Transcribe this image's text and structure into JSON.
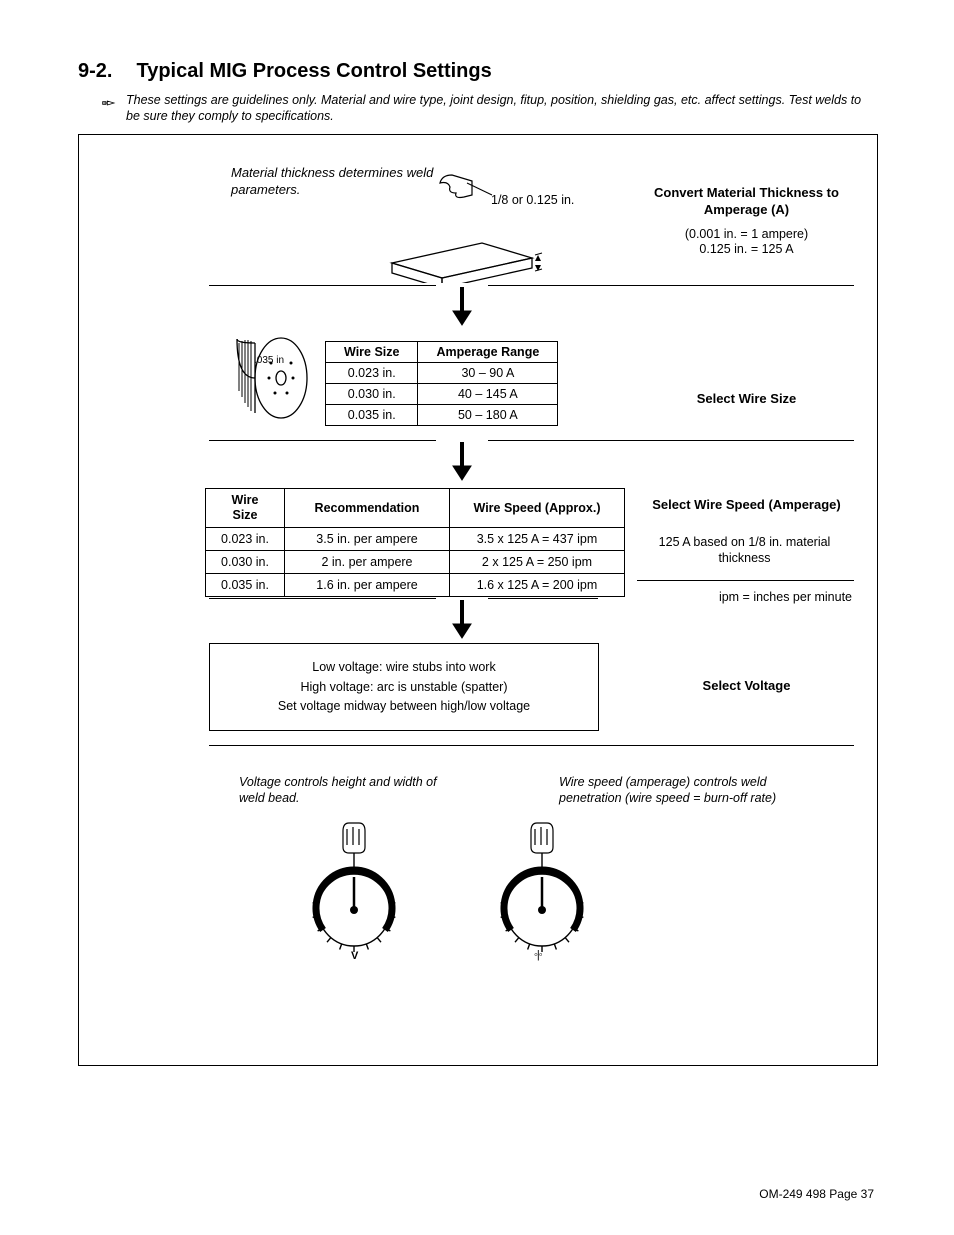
{
  "heading_number": "9-2.",
  "heading_text": "Typical MIG Process Control Settings",
  "note": "These settings are guidelines only. Material and wire type, joint design, fitup, position, shielding gas, etc. affect settings. Test welds to be sure they comply to specifications.",
  "step1": {
    "caption": "Material thickness determines weld parameters.",
    "callout": "1/8 or 0.125 in.",
    "title": "Convert Material Thickness to Amperage (A)",
    "eq1": "(0.001 in.  =  1 ampere)",
    "eq2": "0.125 in.  =  125 A"
  },
  "step2": {
    "spool_label": ".035 in",
    "col1": "Wire Size",
    "col2": "Amperage Range",
    "rows": [
      {
        "a": "0.023 in.",
        "b": "30 – 90 A"
      },
      {
        "a": "0.030 in.",
        "b": "40 – 145 A"
      },
      {
        "a": "0.035 in.",
        "b": "50 – 180 A"
      }
    ],
    "title": "Select Wire Size"
  },
  "step3": {
    "col1": "Wire Size",
    "col2": "Recommendation",
    "col3": "Wire Speed (Approx.)",
    "rows": [
      {
        "a": "0.023 in.",
        "b": "3.5 in. per ampere",
        "c": "3.5 x 125 A = 437 ipm"
      },
      {
        "a": "0.030 in.",
        "b": "2 in. per ampere",
        "c": "2 x 125 A = 250 ipm"
      },
      {
        "a": "0.035 in.",
        "b": "1.6 in. per ampere",
        "c": "1.6 x 125 A = 200 ipm"
      }
    ],
    "title": "Select Wire Speed (Amperage)",
    "sub": "125 A based on 1/8 in. material thickness",
    "foot": "ipm = inches per minute"
  },
  "step4": {
    "l1": "Low voltage: wire stubs into work",
    "l2": "High voltage: arc is unstable (spatter)",
    "l3": "Set voltage midway between high/low voltage",
    "title": "Select Voltage"
  },
  "step5": {
    "left_caption": "Voltage controls height and width of weld bead.",
    "left_glyph": "V",
    "right_caption": "Wire speed (amperage) controls weld penetration (wire speed = burn-off rate)",
    "right_glyph": "◦|◦"
  },
  "footer": "OM-249 498 Page 37"
}
